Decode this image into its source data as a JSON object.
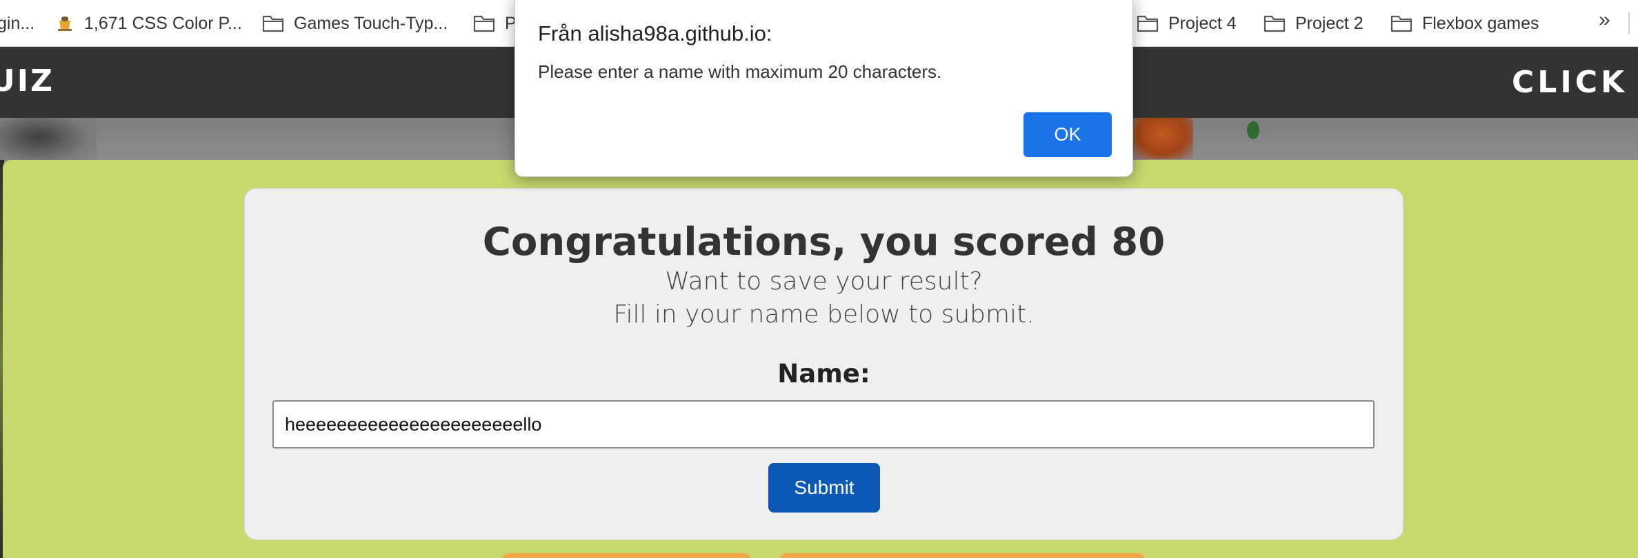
{
  "bookmarks_bar": {
    "items": [
      {
        "label": "gin...",
        "icon": "none"
      },
      {
        "label": "1,671 CSS Color P...",
        "icon": "color-site-icon"
      },
      {
        "label": "Games Touch-Typ...",
        "icon": "folder-icon"
      },
      {
        "label": "P",
        "icon": "folder-icon"
      },
      {
        "label": "Project 4",
        "icon": "folder-icon"
      },
      {
        "label": "Project 2",
        "icon": "folder-icon"
      },
      {
        "label": "Flexbox games",
        "icon": "folder-icon"
      }
    ],
    "more_label": "»"
  },
  "header": {
    "logo_text": "UIZ",
    "nav_link": "CLICK TO"
  },
  "result": {
    "title": "Congratulations, you scored 80",
    "subtitle_line1": "Want to save your result?",
    "subtitle_line2": "Fill in your name below to submit.",
    "name_label": "Name:",
    "name_value": "heeeeeeeeeeeeeeeeeeeeeello",
    "submit_label": "Submit"
  },
  "dialog": {
    "title": "Från alisha98a.github.io:",
    "message": "Please enter a name with maximum 20 characters.",
    "ok_label": "OK"
  },
  "colors": {
    "header_bg": "#333333",
    "quiz_bg": "#c7d86f",
    "card_bg": "#efefef",
    "submit_bg": "#0d57b5",
    "ok_bg": "#1a73e8",
    "accent_orange": "#f2a84a"
  }
}
